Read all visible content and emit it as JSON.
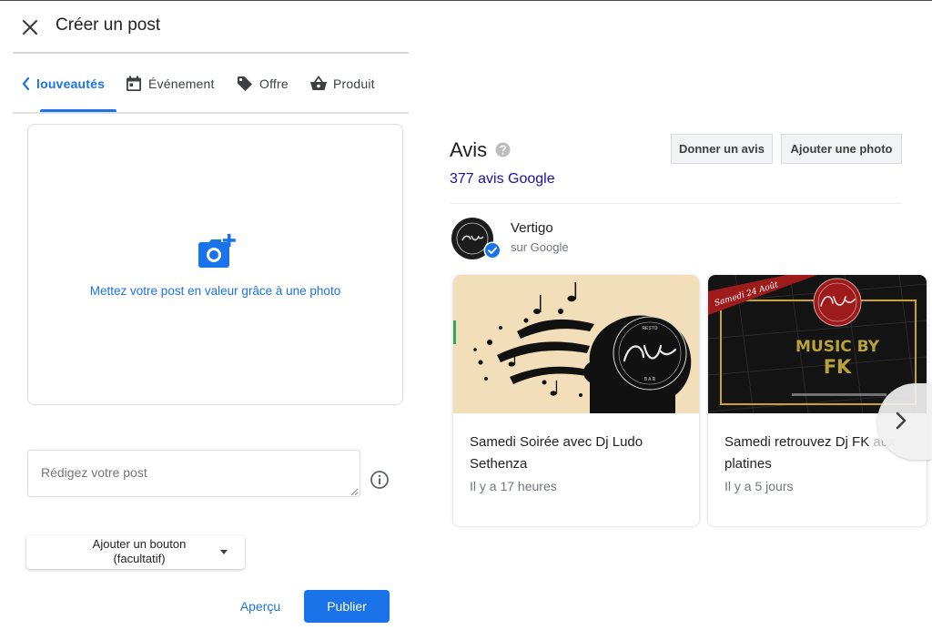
{
  "dialog": {
    "title": "Créer un post"
  },
  "tabs": [
    {
      "label": "louveautés",
      "active": true
    },
    {
      "label": "Événement"
    },
    {
      "label": "Offre"
    },
    {
      "label": "Produit"
    }
  ],
  "photo_upload": {
    "text": "Mettez votre post en valeur grâce à une photo"
  },
  "post": {
    "placeholder": "Rédigez votre post"
  },
  "add_button": {
    "line1": "Ajouter un bouton",
    "line2": "(facultatif)"
  },
  "actions": {
    "preview": "Aperçu",
    "publish": "Publier"
  },
  "reviews": {
    "title": "Avis",
    "count_link": "377 avis Google",
    "give_review": "Donner un avis",
    "add_photo": "Ajouter une photo"
  },
  "profile": {
    "name": "Vertigo",
    "source": "sur Google"
  },
  "posts": [
    {
      "title": "Samedi Soirée avec Dj Ludo Sethenza",
      "time": "Il y a 17 heures",
      "image_logo": "Vertigo"
    },
    {
      "title_main": "Samedi retrouvez Dj FK",
      "title_fade": " aux",
      "title_line2": "platines",
      "time": "Il y a 5 jours",
      "image_banner": "Samedi 24 Août",
      "image_logo": "Vertigo",
      "image_line1": "MUSIC BY",
      "image_line2": "FK"
    }
  ],
  "colors": {
    "accent": "#1a73e8",
    "link": "#1a0dab",
    "text": "#202124",
    "muted": "#70757a"
  }
}
